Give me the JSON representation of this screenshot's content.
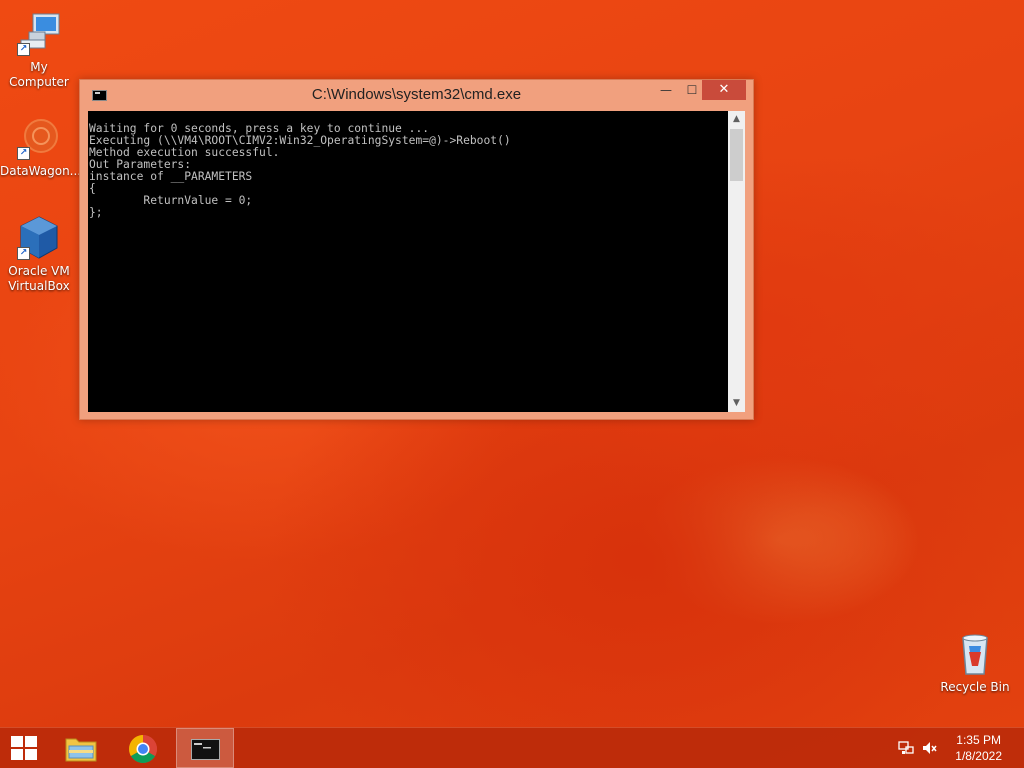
{
  "desktop": {
    "icons": [
      {
        "label": "My Computer",
        "icon": "computer-icon"
      },
      {
        "label": "DataWagon...",
        "icon": "app-icon"
      },
      {
        "label": "Oracle VM VirtualBox",
        "icon": "virtualbox-icon"
      },
      {
        "label": "Recycle Bin",
        "icon": "recycle-bin-icon"
      }
    ]
  },
  "cmd_window": {
    "title": "C:\\Windows\\system32\\cmd.exe",
    "minimize": "—",
    "maximize": "☐",
    "close": "✕",
    "console_text": "Waiting for 0 seconds, press a key to continue ...\nExecuting (\\\\VM4\\ROOT\\CIMV2:Win32_OperatingSystem=@)->Reboot()\nMethod execution successful.\nOut Parameters:\ninstance of __PARAMETERS\n{\n        ReturnValue = 0;\n};"
  },
  "taskbar": {
    "apps": [
      "start",
      "file-explorer",
      "chrome",
      "cmd"
    ],
    "clock_time": "1:35 PM",
    "clock_date": "1/8/2022"
  },
  "colors": {
    "desktop": "#e84412",
    "taskbar": "#ba2a0a",
    "window_frame": "#f1a07e",
    "close_button": "#c94b3b",
    "console_bg": "#000000",
    "console_fg": "#c0c0c0"
  }
}
